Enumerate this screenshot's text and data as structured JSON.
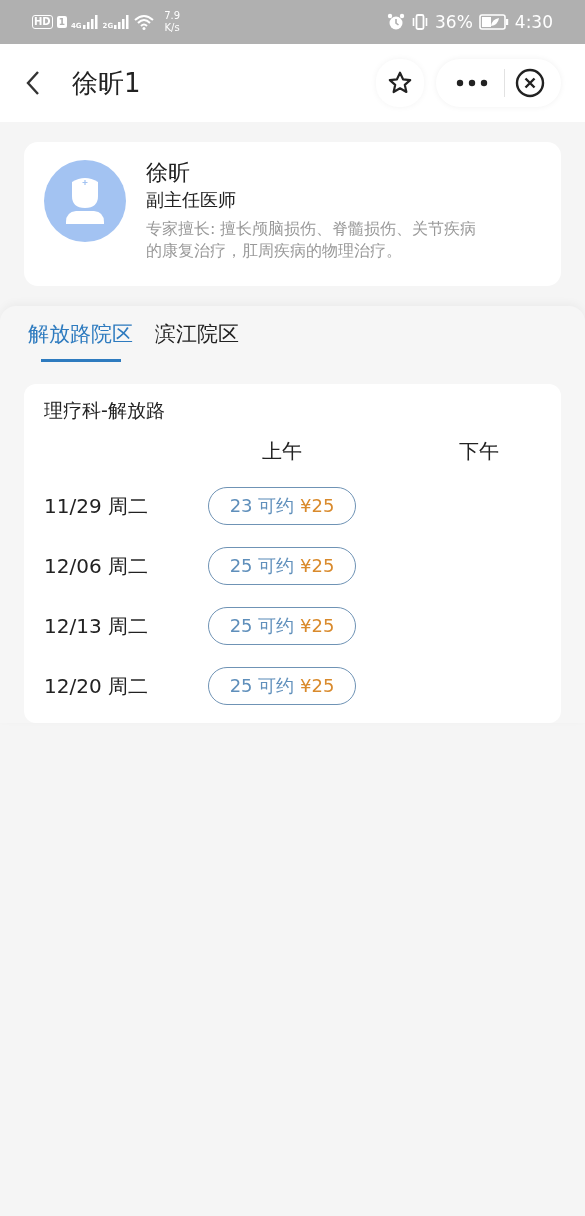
{
  "status_bar": {
    "hd": "HD",
    "sim": "1",
    "network_1": "4G",
    "network_2": "2G",
    "speed": "7.9",
    "speed_unit": "K/s",
    "battery": "36%",
    "time": "4:30"
  },
  "header": {
    "title": "徐昕1"
  },
  "doctor": {
    "name": "徐昕",
    "title": "副主任医师",
    "specialty": "专家擅长: 擅长颅脑损伤、脊髓损伤、关节疾病的康复治疗，肛周疾病的物理治疗。"
  },
  "tabs": [
    {
      "label": "解放路院区",
      "selected": true
    },
    {
      "label": "滨江院区",
      "selected": false
    }
  ],
  "schedule": {
    "department": "理疗科-解放路",
    "columns": [
      "上午",
      "下午"
    ],
    "rows": [
      {
        "date": "11/29 周二",
        "morning": {
          "count": "23",
          "label": "可约",
          "price": "¥25"
        }
      },
      {
        "date": "12/06 周二",
        "morning": {
          "count": "25",
          "label": "可约",
          "price": "¥25"
        }
      },
      {
        "date": "12/13 周二",
        "morning": {
          "count": "25",
          "label": "可约",
          "price": "¥25"
        }
      },
      {
        "date": "12/20 周二",
        "morning": {
          "count": "25",
          "label": "可约",
          "price": "¥25"
        }
      }
    ]
  }
}
